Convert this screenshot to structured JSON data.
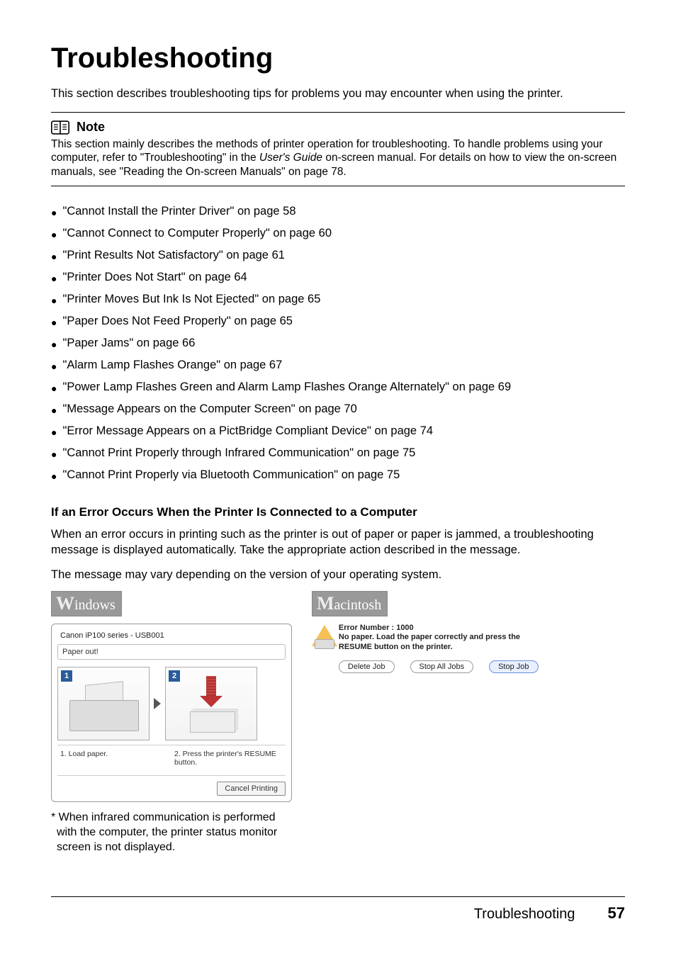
{
  "title": "Troubleshooting",
  "intro": "This section describes troubleshooting tips for problems you may encounter when using the printer.",
  "note": {
    "heading": "Note",
    "body_pre": "This section mainly describes the methods of printer operation for troubleshooting. To handle problems using your computer, refer to \"Troubleshooting\" in the ",
    "body_em": "User's Guide",
    "body_post": " on-screen manual. For details on how to view the on-screen manuals, see \"Reading the On-screen Manuals\" on page 78."
  },
  "toc": [
    "\"Cannot Install the Printer Driver\" on page 58",
    "\"Cannot Connect to Computer Properly\" on page 60",
    "\"Print Results Not Satisfactory\" on page 61",
    "\"Printer Does Not Start\" on page 64",
    "\"Printer Moves But Ink Is Not Ejected\" on page 65",
    "\"Paper Does Not Feed Properly\" on page 65",
    "\"Paper Jams\" on page 66",
    "\"Alarm Lamp Flashes Orange\" on page 67",
    "\"Power Lamp Flashes Green and Alarm Lamp Flashes Orange Alternately\" on page 69",
    "\"Message Appears on the Computer Screen\" on page 70",
    "\"Error Message Appears on a PictBridge Compliant Device\" on page 74",
    "\"Cannot Print Properly through Infrared Communication\" on page 75",
    "\"Cannot Print Properly via Bluetooth Communication\" on page 75"
  ],
  "subhead": "If an Error Occurs When the Printer Is Connected to a Computer",
  "para1": "When an error occurs in printing such as the printer is out of paper or paper is jammed, a troubleshooting message is displayed automatically. Take the appropriate action described in the message.",
  "para2": "The message may vary depending on the version of your operating system.",
  "windows": {
    "badge": "Windows",
    "dialog_title": "Canon iP100 series - USB001",
    "paper_out": "Paper out!",
    "step1_tag": "1",
    "step2_tag": "2",
    "caption1": "1.  Load paper.",
    "caption2": "2.  Press the printer's RESUME button.",
    "cancel_btn": "Cancel Printing",
    "footnote": "* When infrared communication is performed with the computer, the printer status monitor screen is not displayed."
  },
  "mac": {
    "badge": "Macintosh",
    "error_number": "Error Number : 1000",
    "error_msg": "No paper. Load the paper correctly and press the RESUME button on the printer.",
    "btn_delete": "Delete Job",
    "btn_stop_all": "Stop All Jobs",
    "btn_stop": "Stop Job"
  },
  "footer": {
    "section": "Troubleshooting",
    "page": "57"
  }
}
